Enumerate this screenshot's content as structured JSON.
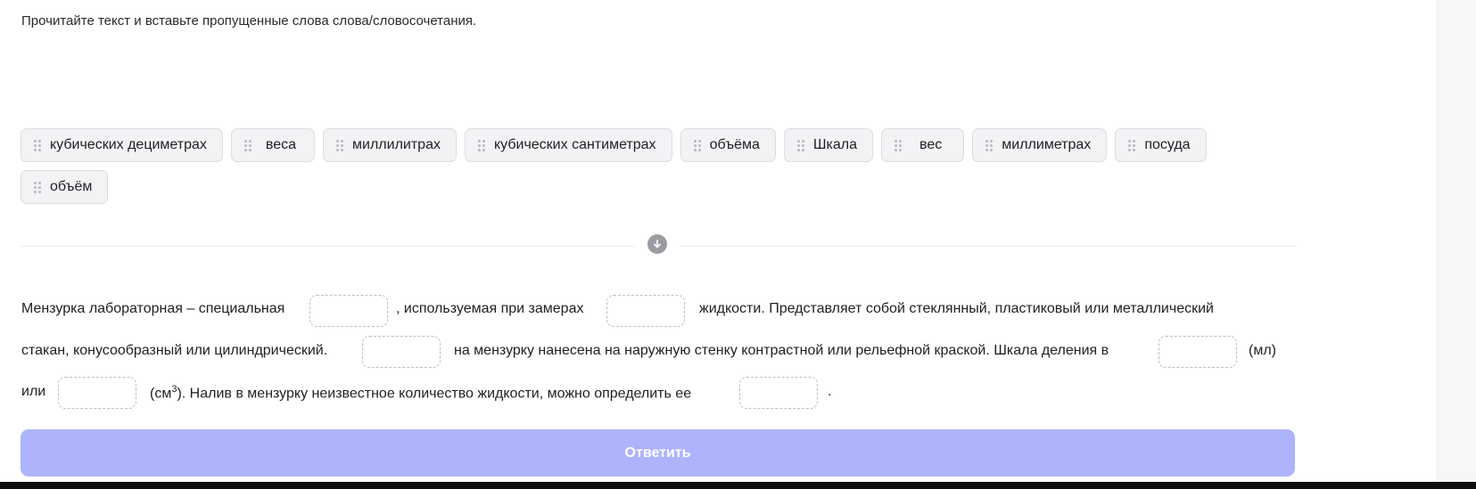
{
  "instruction": "Прочитайте текст и вставьте пропущенные слова слова/словосочетания.",
  "word_bank": [
    "кубических дециметрах",
    "веса",
    "миллилитрах",
    "кубических сантиметрах",
    "объёма",
    "Шкала",
    "вес",
    "миллиметрах",
    "посуда",
    "объём"
  ],
  "passage": {
    "l1_a": "Мензурка лабораторная – специальная",
    "l1_b": ", используемая при замерах",
    "l1_c": "жидкости. Представляет собой стеклянный, пластиковый или металлический",
    "l2_a": "стакан, конусообразный или цилиндрический.",
    "l2_b": "на мензурку нанесена на наружную стенку контрастной или рельефной краской. Шкала деления в",
    "l2_c": "(мл)",
    "l3_a": "или",
    "l3_b1": "(см",
    "l3_sup": "3",
    "l3_b2": "). Налив в мензурку неизвестное количество жидкости, можно определить ее",
    "l3_c": "."
  },
  "answer_button": "Ответить",
  "colors": {
    "accent_disabled": "#aeb4fb",
    "chip_bg": "#f3f3f5",
    "gap_border": "#bcbcc4"
  },
  "icons": {
    "chip_handle": "drag-handle-icon",
    "divider": "arrow-down-circle-icon"
  }
}
